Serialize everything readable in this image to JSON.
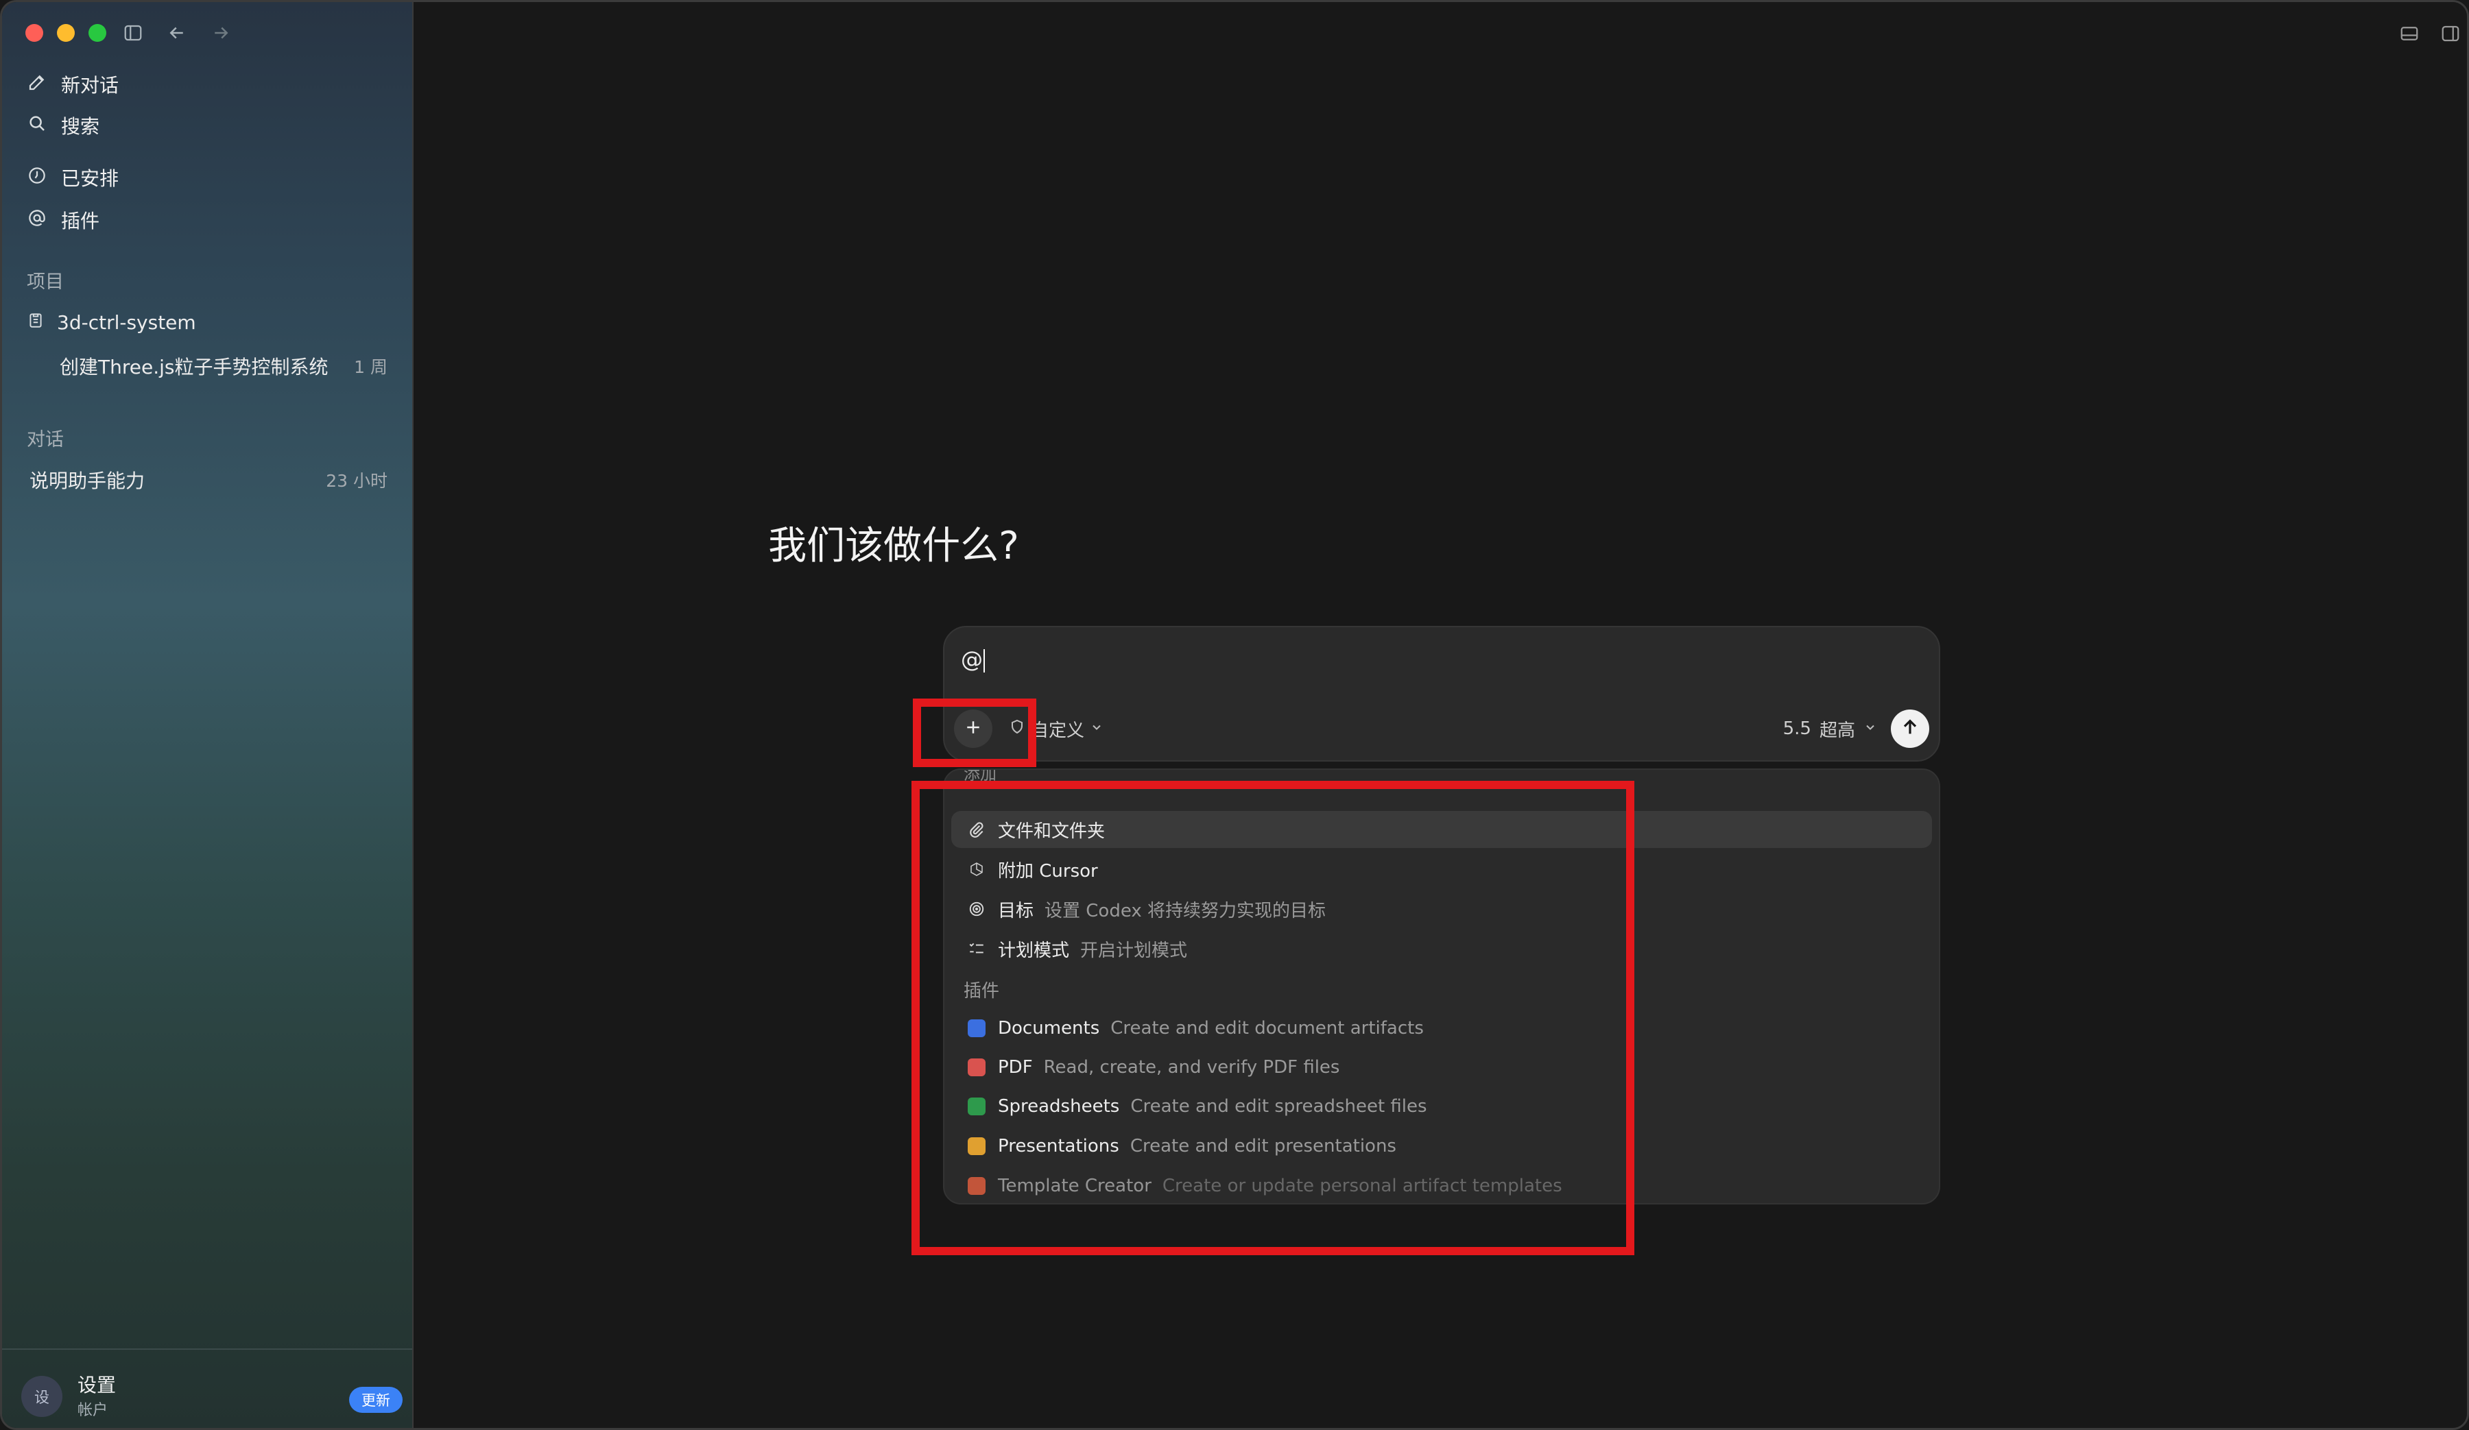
{
  "sidebar": {
    "nav": [
      {
        "label": "新对话",
        "icon": "edit-icon"
      },
      {
        "label": "搜索",
        "icon": "search-icon"
      },
      {
        "label": "已安排",
        "icon": "clock-icon"
      },
      {
        "label": "插件",
        "icon": "at-icon"
      }
    ],
    "projects_label": "项目",
    "project": {
      "name": "3d-ctrl-system",
      "icon": "clipboard-icon"
    },
    "project_thread": {
      "title": "创建Three.js粒子手势控制系统",
      "time": "1 周"
    },
    "conversations_label": "对话",
    "conversation": {
      "title": "说明助手能力",
      "time": "23 小时"
    },
    "footer": {
      "avatar": "设",
      "title": "设置",
      "subtitle": "帐户",
      "badge": "更新"
    }
  },
  "main": {
    "heading": "我们该做什么?",
    "composer": {
      "value": "@",
      "permission_label": "自定义",
      "model_version": "5.5",
      "model_effort": "超高"
    },
    "menu": {
      "header": "添加",
      "items": [
        {
          "label": "文件和文件夹",
          "desc": "",
          "icon": "paperclip-icon"
        },
        {
          "label": "附加 Cursor",
          "desc": "",
          "icon": "cursor-icon"
        },
        {
          "label": "目标",
          "desc": "设置 Codex 将持续努力实现的目标",
          "icon": "target-icon"
        },
        {
          "label": "计划模式",
          "desc": "开启计划模式",
          "icon": "checklist-icon"
        }
      ],
      "plugins_label": "插件",
      "plugins": [
        {
          "label": "Documents",
          "desc": "Create and edit document artifacts",
          "color": "#3b6fe0"
        },
        {
          "label": "PDF",
          "desc": "Read, create, and verify PDF files",
          "color": "#d9534f"
        },
        {
          "label": "Spreadsheets",
          "desc": "Create and edit spreadsheet files",
          "color": "#2e9a4c"
        },
        {
          "label": "Presentations",
          "desc": "Create and edit presentations",
          "color": "#e0a030"
        },
        {
          "label": "Template Creator",
          "desc": "Create or update personal artifact templates",
          "color": "#c2553a"
        }
      ]
    }
  },
  "colors": {
    "highlight": "#e3181c",
    "accent": "#3b82f6"
  }
}
